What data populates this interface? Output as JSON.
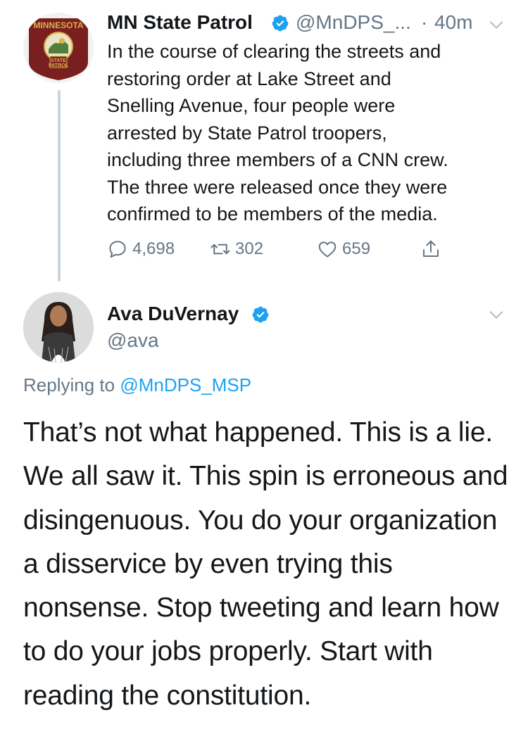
{
  "tweet1": {
    "display_name": "MN State Patrol",
    "handle": "@MnDPS_...",
    "separator": "·",
    "time": "40m",
    "text": "In the course of clearing the streets and\nrestoring order at Lake Street and\nSnelling Avenue, four people were\narrested by State Patrol troopers,\nincluding three members of a CNN crew.\nThe three were released once they were\nconfirmed to be members of the media.",
    "avatar": {
      "badge_top": "MINNESOTA",
      "badge_bottom": "STATE\nPATROL"
    },
    "actions": {
      "replies": "4,698",
      "retweets": "302",
      "likes": "659",
      "icons": [
        "reply-icon",
        "retweet-icon",
        "like-icon",
        "share-icon"
      ]
    }
  },
  "tweet2": {
    "display_name": "Ava DuVernay",
    "handle": "@ava",
    "replying_prefix": "Replying to ",
    "replying_to": "@MnDPS_MSP",
    "text": "That’s not what happened. This is a lie. We all saw it. This spin is erroneous and disingenuous. You do your organization a disservice by even trying this nonsense. Stop tweeting and learn how to do your jobs properly. Start with reading the constitution."
  },
  "colors": {
    "text": "#14171a",
    "secondary": "#657786",
    "link": "#1da1f2",
    "verified": "#1da1f2",
    "thread_line": "#ccd6dd",
    "patrol_maroon": "#7a1f1f",
    "patrol_gold": "#d8b04a"
  }
}
